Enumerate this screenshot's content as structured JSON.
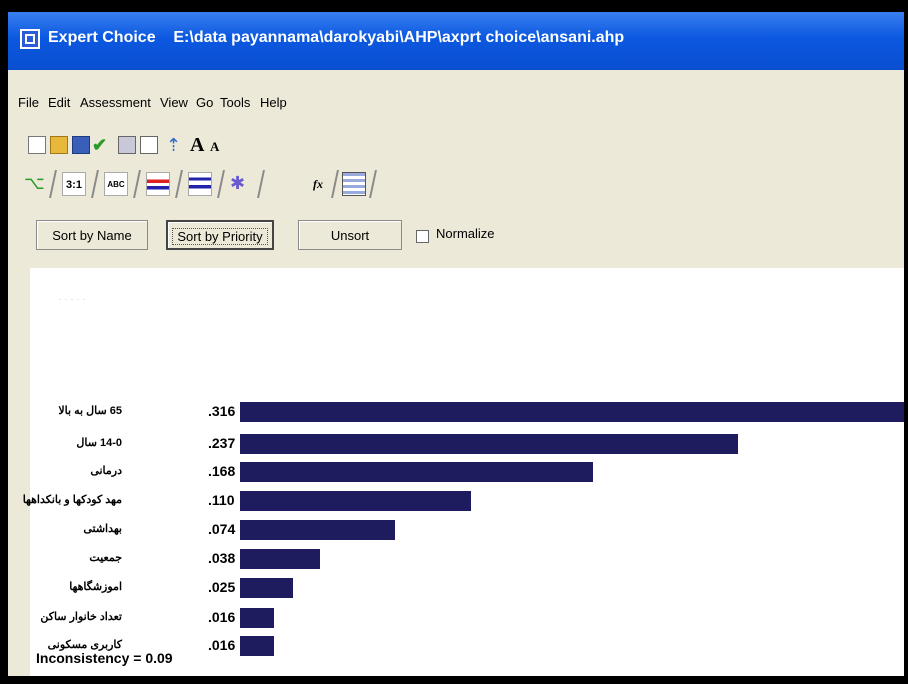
{
  "window": {
    "app_name": "Expert Choice",
    "file_path": "E:\\data payannama\\darokyabi\\AHP\\axprt choice\\ansani.ahp"
  },
  "menu": [
    "File",
    "Edit",
    "Assessment",
    "View",
    "Go",
    "Tools",
    "Help"
  ],
  "toolbar_icons": [
    "new-file-icon",
    "open-folder-icon",
    "save-icon",
    "checkmark-icon",
    "print-icon",
    "print-preview-icon",
    "arrow-icon",
    "font-larger-icon",
    "font-smaller-icon"
  ],
  "view_tabs": [
    {
      "icon": "tree-view-icon"
    },
    {
      "icon": "pairwise-icon",
      "label": "3:1"
    },
    {
      "icon": "verbal-icon",
      "label": "ABC"
    },
    {
      "icon": "graphical-icon"
    },
    {
      "icon": "priority-bars-icon"
    },
    {
      "icon": "sensitivity-icon"
    },
    {
      "icon": "formula-icon",
      "label": "fx"
    },
    {
      "icon": "data-grid-icon"
    }
  ],
  "sort_bar": {
    "sort_by_name": "Sort by Name",
    "sort_by_priority": "Sort by Priority",
    "unsort": "Unsort",
    "normalize": "Normalize",
    "normalize_checked": false
  },
  "chart_data": {
    "type": "bar",
    "orientation": "horizontal",
    "categories": [
      "65 سال به بالا",
      "14-0 سال",
      "درمانی",
      "مهد کودکها و بانکداهها",
      "بهداشتی",
      "جمعیت",
      "اموزشگاهها",
      "تعداد خانوار ساکن",
      "کاربری مسکونی"
    ],
    "values": [
      0.316,
      0.237,
      0.168,
      0.11,
      0.074,
      0.038,
      0.025,
      0.016,
      0.016
    ],
    "value_labels": [
      ".316",
      ".237",
      ".168",
      ".110",
      ".074",
      ".038",
      ".025",
      ".016",
      ".016"
    ],
    "bar_color": "#1e1c5e",
    "xlim": [
      0,
      0.316
    ]
  },
  "inconsistency": "Inconsistency = 0.09"
}
